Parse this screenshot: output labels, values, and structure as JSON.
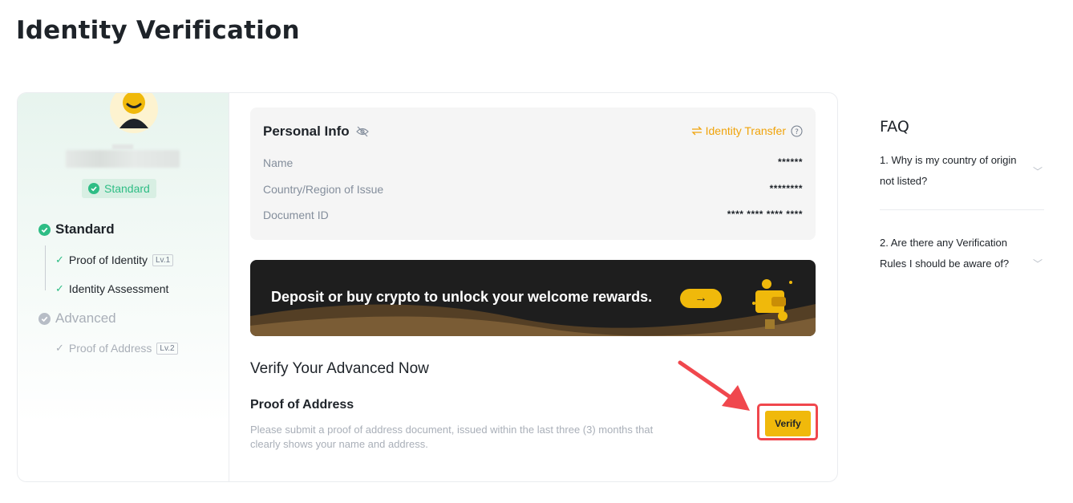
{
  "page": {
    "title": "Identity Verification"
  },
  "profile": {
    "badge_label": "Standard",
    "levels": [
      {
        "name": "Standard",
        "items": [
          {
            "label": "Proof of Identity",
            "tag": "Lv.1"
          },
          {
            "label": "Identity Assessment",
            "tag": ""
          }
        ]
      },
      {
        "name": "Advanced",
        "items": [
          {
            "label": "Proof of Address",
            "tag": "Lv.2"
          }
        ]
      }
    ]
  },
  "personal_info": {
    "title": "Personal Info",
    "transfer_label": "Identity Transfer",
    "rows": [
      {
        "label": "Name",
        "value": "******"
      },
      {
        "label": "Country/Region of Issue",
        "value": "********"
      },
      {
        "label": "Document ID",
        "value": "**** **** **** ****"
      }
    ]
  },
  "banner": {
    "text": "Deposit or buy crypto to unlock your welcome rewards.",
    "arrow": "→"
  },
  "advanced": {
    "heading": "Verify Your Advanced Now",
    "proof_title": "Proof of Address",
    "proof_desc": "Please submit a proof of address document, issued within the last three (3) months that clearly shows your name and address.",
    "verify_label": "Verify"
  },
  "faq": {
    "title": "FAQ",
    "items": [
      "1. Why is my country of origin not listed?",
      "2. Are there any Verification Rules I should be aware of?"
    ]
  },
  "colors": {
    "accent": "#f0b90b",
    "success": "#2ebd85",
    "highlight": "#f0474d",
    "transfer": "#f0a30a"
  }
}
